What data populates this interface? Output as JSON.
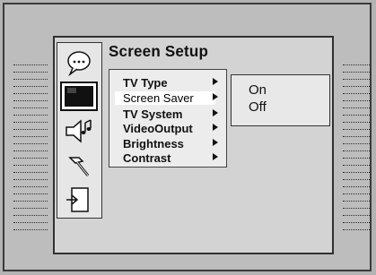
{
  "screen": {
    "title": "Screen Setup"
  },
  "menu": {
    "items": [
      {
        "label": "TV Type"
      },
      {
        "label": "Screen Saver"
      },
      {
        "label": "TV System"
      },
      {
        "label": "VideoOutput"
      },
      {
        "label": "Brightness"
      },
      {
        "label": "Contrast"
      }
    ],
    "selected": "Screen Saver"
  },
  "submenu": {
    "options": [
      "On",
      "Off"
    ]
  },
  "icons": [
    "language-icon",
    "tv-screen-icon",
    "audio-icon",
    "tools-icon",
    "exit-icon"
  ],
  "colors": {
    "background": "#b3b3b3",
    "screen": "#d3d3d3",
    "menu": "#ececec",
    "selected": "#ffffff"
  }
}
